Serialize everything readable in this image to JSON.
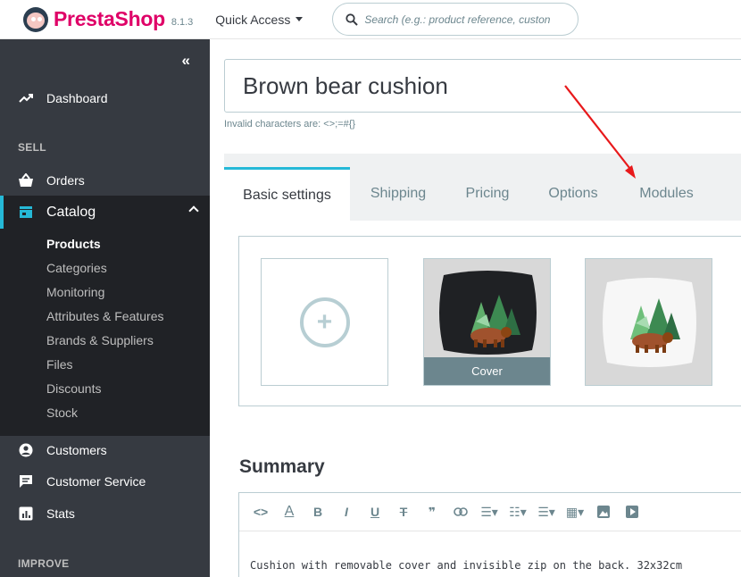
{
  "header": {
    "brand": "PrestaShop",
    "version": "8.1.3",
    "quick_access": "Quick Access",
    "search_placeholder": "Search (e.g.: product reference, custon"
  },
  "sidebar": {
    "collapse_glyph": "«",
    "dashboard": "Dashboard",
    "sell_label": "SELL",
    "orders": "Orders",
    "catalog": "Catalog",
    "catalog_items": [
      "Products",
      "Categories",
      "Monitoring",
      "Attributes & Features",
      "Brands & Suppliers",
      "Files",
      "Discounts",
      "Stock"
    ],
    "customers": "Customers",
    "customer_service": "Customer Service",
    "stats": "Stats",
    "improve_label": "IMPROVE"
  },
  "product": {
    "name": "Brown bear cushion",
    "hint": "Invalid characters are: <>;=#{}"
  },
  "tabs": [
    "Basic settings",
    "Shipping",
    "Pricing",
    "Options",
    "Modules"
  ],
  "images": {
    "add_glyph": "+",
    "cover_label": "Cover"
  },
  "summary": {
    "title": "Summary",
    "text": "Cushion with removable cover and invisible zip on the back. 32x32cm"
  },
  "colors": {
    "brand": "#df0067",
    "accent": "#25b9d7",
    "sidebar_bg": "#363a41",
    "annotation_arrow": "#e8191b"
  }
}
